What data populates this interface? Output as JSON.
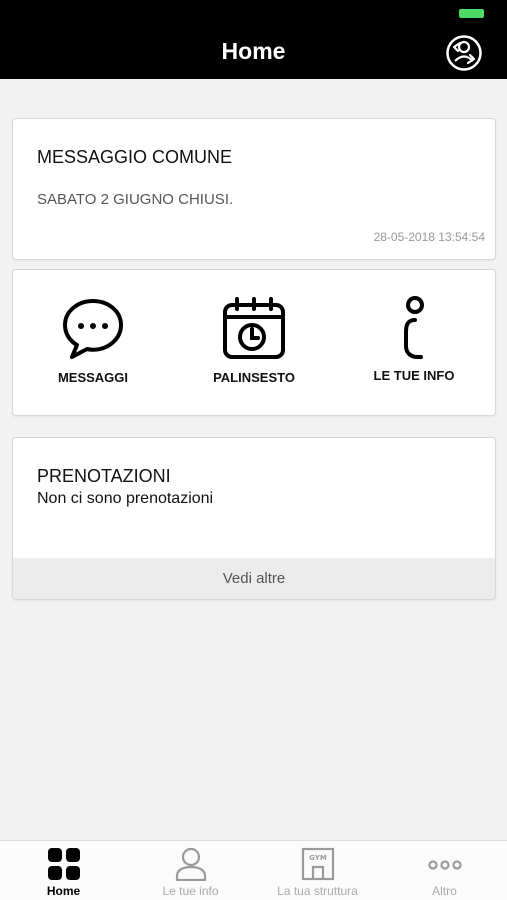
{
  "header": {
    "title": "Home"
  },
  "message_card": {
    "title": "MESSAGGIO COMUNE",
    "body": "SABATO 2 GIUGNO CHIUSI.",
    "timestamp": "28-05-2018 13:54:54"
  },
  "actions": [
    {
      "label": "MESSAGGI",
      "icon": "chat-bubble-icon"
    },
    {
      "label": "PALINSESTO",
      "icon": "calendar-clock-icon"
    },
    {
      "label": "LE TUE INFO",
      "icon": "info-icon"
    }
  ],
  "bookings_card": {
    "title": "PRENOTAZIONI",
    "empty_text": "Non ci sono prenotazioni",
    "more_label": "Vedi altre"
  },
  "tabbar": {
    "items": [
      {
        "label": "Home",
        "icon": "grid-icon",
        "active": true
      },
      {
        "label": "Le tue info",
        "icon": "person-icon",
        "active": false
      },
      {
        "label": "La tua struttura",
        "icon": "gym-building-icon",
        "active": false
      },
      {
        "label": "Altro",
        "icon": "more-icon",
        "active": false
      }
    ]
  },
  "colors": {
    "header_bg": "#000000",
    "battery": "#4cd964",
    "page_bg": "#f3f3f3"
  }
}
